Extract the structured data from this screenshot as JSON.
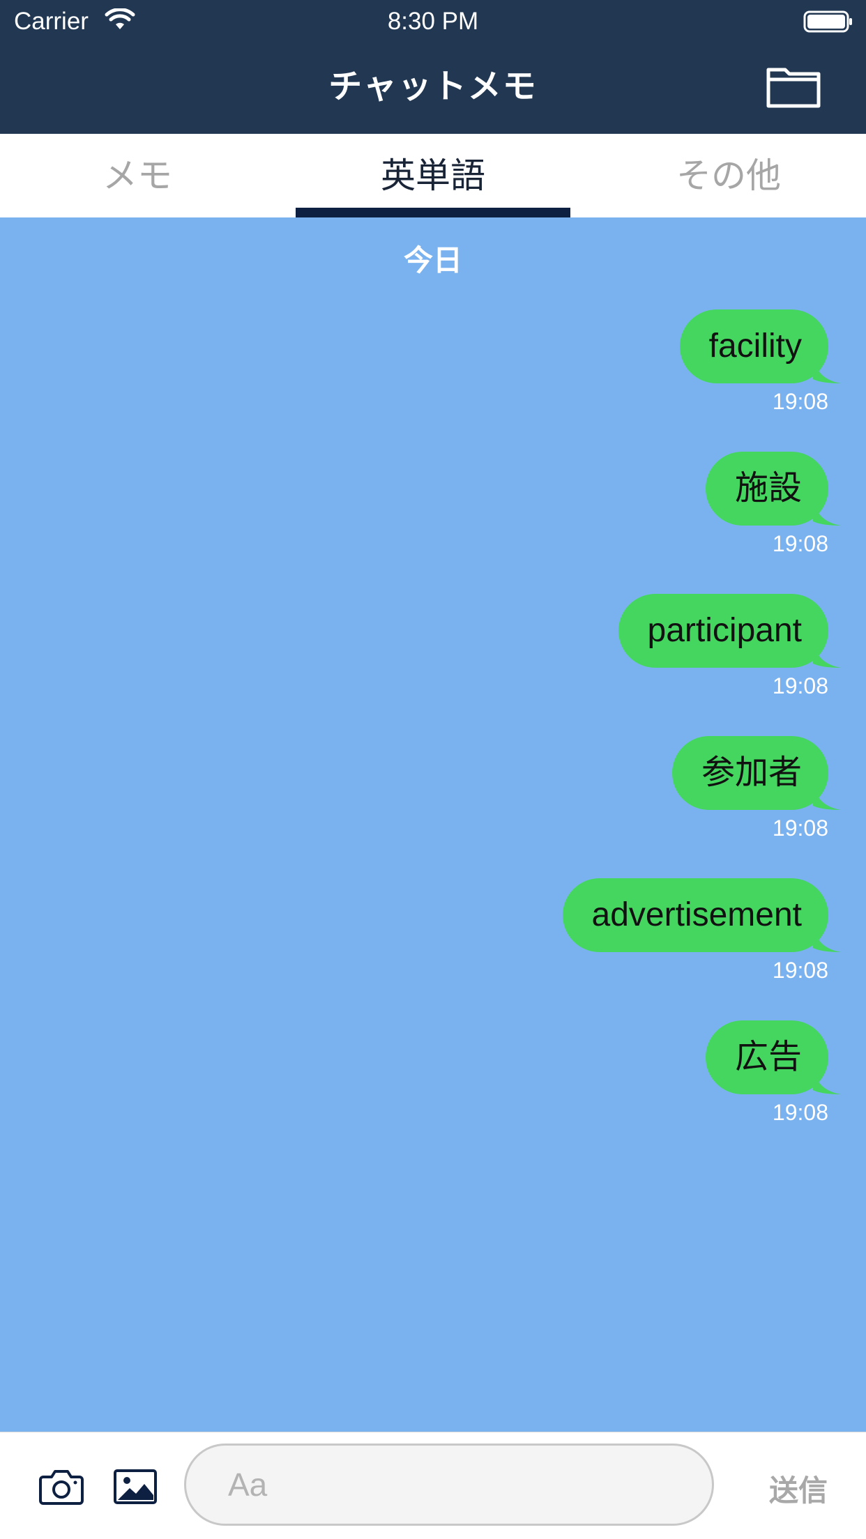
{
  "status_bar": {
    "carrier": "Carrier",
    "time": "8:30 PM",
    "wifi_icon": "wifi-icon",
    "battery_icon": "battery-icon"
  },
  "nav": {
    "title": "チャットメモ",
    "folder_icon": "folder-icon"
  },
  "tabs": [
    {
      "label": "メモ",
      "active": false
    },
    {
      "label": "英単語",
      "active": true
    },
    {
      "label": "その他",
      "active": false
    }
  ],
  "chat": {
    "day_label": "今日",
    "messages": [
      {
        "text": "facility",
        "time": "19:08"
      },
      {
        "text": "施設",
        "time": "19:08"
      },
      {
        "text": "participant",
        "time": "19:08"
      },
      {
        "text": "参加者",
        "time": "19:08"
      },
      {
        "text": "advertisement",
        "time": "19:08"
      },
      {
        "text": "広告",
        "time": "19:08"
      }
    ]
  },
  "composer": {
    "camera_icon": "camera-icon",
    "image_icon": "image-icon",
    "placeholder": "Aa",
    "value": "",
    "send_label": "送信"
  },
  "colors": {
    "nav_background": "#213752",
    "tab_indicator": "#0e2041",
    "chat_background": "#7ab2ef",
    "bubble": "#45d65f"
  }
}
